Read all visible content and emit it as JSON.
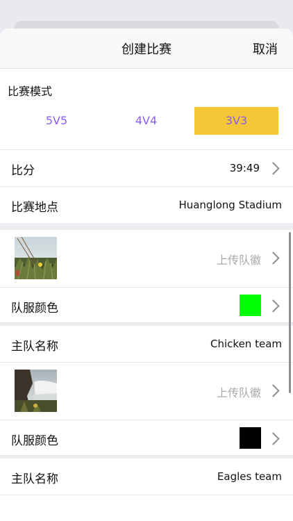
{
  "nav": {
    "title": "创建比赛",
    "cancel": "取消"
  },
  "mode": {
    "label": "比赛模式",
    "options": [
      "5V5",
      "4V4",
      "3V3"
    ],
    "selected": "3V3",
    "accent_color": "#f5c637",
    "text_color": "#8a5cf0"
  },
  "score": {
    "label": "比分",
    "value": "39:49"
  },
  "venue": {
    "label": "比赛地点",
    "value": "Huanglong Stadium"
  },
  "team1": {
    "upload_text": "上传队徽",
    "jersey_label": "队服颜色",
    "jersey_color": "#00ff00",
    "name_label": "主队名称",
    "name_value": "Chicken team"
  },
  "team2": {
    "upload_text": "上传队徽",
    "jersey_label": "队服颜色",
    "jersey_color": "#000000",
    "name_label": "主队名称",
    "name_value": "Eagles team"
  }
}
